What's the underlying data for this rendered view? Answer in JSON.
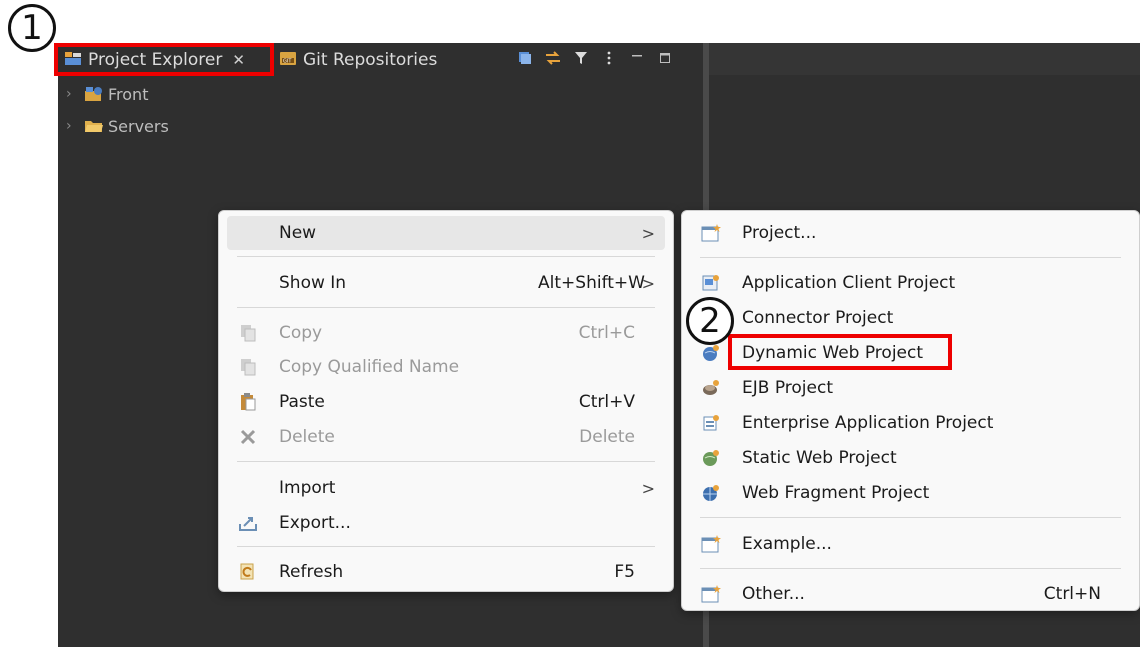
{
  "tabs": [
    {
      "label": "Project Explorer",
      "close": "✕",
      "icon": "project-explorer-icon",
      "active": true
    },
    {
      "label": "Git Repositories",
      "icon": "git-repositories-icon",
      "active": false
    }
  ],
  "view_toolbar": [
    "collapse-all-icon",
    "link-with-editor-icon",
    "filter-icon",
    "view-menu-icon",
    "minimize-icon",
    "maximize-icon"
  ],
  "tree": [
    {
      "label": "Front",
      "icon": "web-project-icon"
    },
    {
      "label": "Servers",
      "icon": "folder-icon"
    }
  ],
  "context_menu": {
    "new": {
      "label": "New",
      "arrow": ">"
    },
    "show_in": {
      "label": "Show In",
      "accel": "Alt+Shift+W",
      "arrow": ">"
    },
    "copy": {
      "label": "Copy",
      "accel": "Ctrl+C",
      "disabled": true
    },
    "copy_qualified": {
      "label": "Copy Qualified Name",
      "disabled": true
    },
    "paste": {
      "label": "Paste",
      "accel": "Ctrl+V"
    },
    "delete": {
      "label": "Delete",
      "accel": "Delete",
      "disabled": true
    },
    "import": {
      "label": "Import",
      "arrow": ">"
    },
    "export": {
      "label": "Export..."
    },
    "refresh": {
      "label": "Refresh",
      "accel": "F5"
    }
  },
  "submenu": {
    "project": {
      "label": "Project..."
    },
    "app_client": {
      "label": "Application Client Project"
    },
    "connector": {
      "label": "Connector Project"
    },
    "dynamic_web": {
      "label": "Dynamic Web Project"
    },
    "ejb": {
      "label": "EJB Project"
    },
    "enterprise_app": {
      "label": "Enterprise Application Project"
    },
    "static_web": {
      "label": "Static Web Project"
    },
    "web_fragment": {
      "label": "Web Fragment Project"
    },
    "example": {
      "label": "Example..."
    },
    "other": {
      "label": "Other...",
      "accel": "Ctrl+N"
    }
  },
  "annotations": {
    "step1": "1",
    "step2": "2",
    "highlight_color": "#ee0000"
  },
  "colors": {
    "workbench_bg": "#2f2f2f",
    "menu_bg": "#f9f9f9",
    "menu_highlight": "#e7e7e7"
  }
}
